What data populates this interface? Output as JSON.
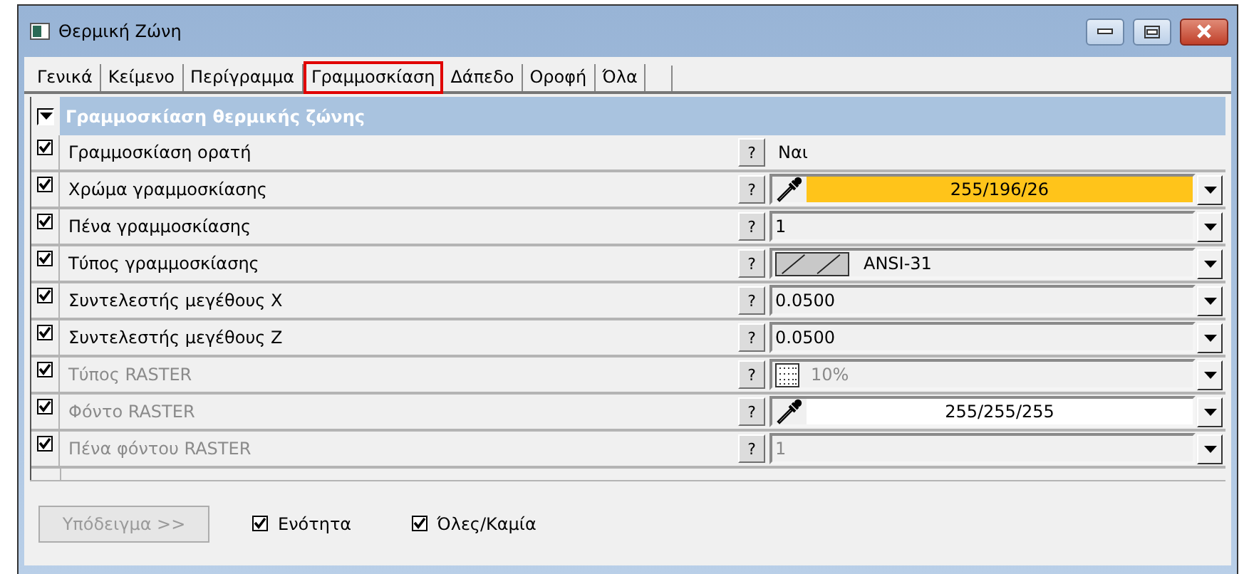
{
  "window": {
    "title": "Θερμική Ζώνη"
  },
  "tabs": [
    {
      "label": "Γενικά",
      "selected": false
    },
    {
      "label": "Κείμενο",
      "selected": false
    },
    {
      "label": "Περίγραμμα",
      "selected": false
    },
    {
      "label": "Γραμμοσκίαση",
      "selected": true
    },
    {
      "label": "Δάπεδο",
      "selected": false
    },
    {
      "label": "Οροφή",
      "selected": false
    },
    {
      "label": "Όλα",
      "selected": false
    }
  ],
  "section": {
    "title": "Γραμμοσκίαση θερμικής ζώνης",
    "expanded": true
  },
  "rows": [
    {
      "label": "Γραμμοσκίαση ορατή",
      "checked": true,
      "disabled": false,
      "help": "?",
      "kind": "plain",
      "value": "Ναι"
    },
    {
      "label": "Χρώμα γραμμοσκίασης",
      "checked": true,
      "disabled": false,
      "help": "?",
      "kind": "color",
      "value": "255/196/26",
      "color": "#ffc41a"
    },
    {
      "label": "Πένα γραμμοσκίασης",
      "checked": true,
      "disabled": false,
      "help": "?",
      "kind": "field",
      "value": "1"
    },
    {
      "label": "Τύπος γραμμοσκίασης",
      "checked": true,
      "disabled": false,
      "help": "?",
      "kind": "hatch",
      "value": "ANSI-31"
    },
    {
      "label": "Συντελεστής μεγέθους X",
      "checked": true,
      "disabled": false,
      "help": "?",
      "kind": "field",
      "value": "0.0500"
    },
    {
      "label": "Συντελεστής μεγέθους Z",
      "checked": true,
      "disabled": false,
      "help": "?",
      "kind": "field",
      "value": "0.0500"
    },
    {
      "label": "Τύπος RASTER",
      "checked": true,
      "disabled": true,
      "help": "?",
      "kind": "raster",
      "value": "10%"
    },
    {
      "label": "Φόντο RASTER",
      "checked": true,
      "disabled": true,
      "help": "?",
      "kind": "color",
      "value": "255/255/255",
      "color": "#ffffff"
    },
    {
      "label": "Πένα φόντου RASTER",
      "checked": true,
      "disabled": true,
      "help": "?",
      "kind": "field",
      "value": "1"
    }
  ],
  "footer": {
    "button": {
      "label": "Υπόδειγμα >>",
      "disabled": true
    },
    "checkboxes": [
      {
        "label": "Ενότητα",
        "checked": true
      },
      {
        "label": "Όλες/Καμία",
        "checked": true
      }
    ]
  }
}
